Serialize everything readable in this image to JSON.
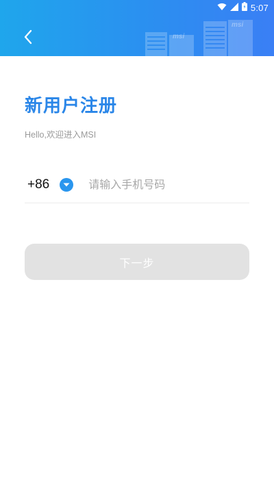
{
  "status_bar": {
    "time": "5:07",
    "icons": [
      "wifi-icon",
      "signal-icon",
      "battery-icon"
    ]
  },
  "header": {
    "back_icon": "chevron-left-icon",
    "logo_text": "msi"
  },
  "page": {
    "title": "新用户注册",
    "subtitle": "Hello,欢迎进入MSI"
  },
  "phone": {
    "country_code": "+86",
    "dropdown_icon": "chevron-down-icon",
    "placeholder": "请输入手机号码",
    "value": ""
  },
  "next_button": {
    "label": "下一步"
  },
  "colors": {
    "header_start": "#1fa6ec",
    "header_end": "#3a7ff5",
    "title": "#2a86e8",
    "dropdown": "#2a96ee",
    "button_disabled": "#e2e2e2"
  }
}
